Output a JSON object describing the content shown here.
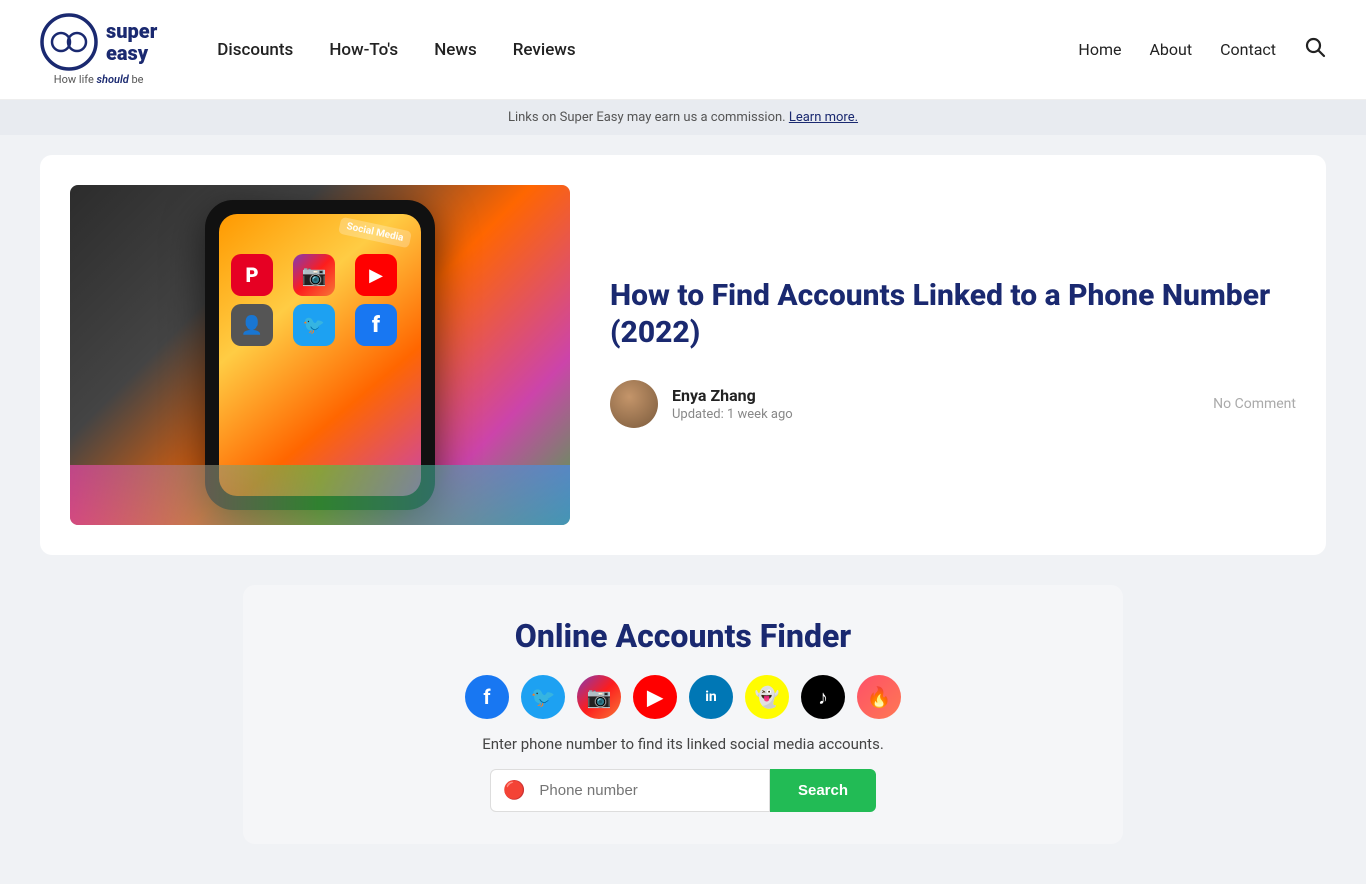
{
  "header": {
    "logo": {
      "brand1": "super",
      "brand2": "easy",
      "tagline_prefix": "How life ",
      "tagline_emphasis": "should",
      "tagline_suffix": " be"
    },
    "nav": {
      "items": [
        {
          "label": "Discounts",
          "href": "#"
        },
        {
          "label": "How-To's",
          "href": "#"
        },
        {
          "label": "News",
          "href": "#"
        },
        {
          "label": "Reviews",
          "href": "#"
        }
      ]
    },
    "secondary_nav": {
      "items": [
        {
          "label": "Home",
          "href": "#"
        },
        {
          "label": "About",
          "href": "#"
        },
        {
          "label": "Contact",
          "href": "#"
        }
      ]
    }
  },
  "commission_bar": {
    "text": "Links on Super Easy may earn us a commission.",
    "link_text": "Learn more."
  },
  "article": {
    "title": "How to Find Accounts Linked to a Phone Number (2022)",
    "author": {
      "name": "Enya Zhang",
      "updated": "Updated: 1 week ago"
    },
    "comment_count": "No Comment"
  },
  "finder": {
    "title": "Online Accounts Finder",
    "description": "Enter phone number to find its linked social media accounts.",
    "input_placeholder": "Phone number",
    "button_label": "Search",
    "social_icons": [
      {
        "name": "facebook",
        "symbol": "f",
        "class": "si-facebook"
      },
      {
        "name": "twitter",
        "symbol": "t",
        "class": "si-twitter"
      },
      {
        "name": "instagram",
        "symbol": "📷",
        "class": "si-instagram"
      },
      {
        "name": "youtube",
        "symbol": "▶",
        "class": "si-youtube"
      },
      {
        "name": "linkedin",
        "symbol": "in",
        "class": "si-linkedin"
      },
      {
        "name": "snapchat",
        "symbol": "👻",
        "class": "si-snapchat"
      },
      {
        "name": "tiktok",
        "symbol": "♪",
        "class": "si-tiktok"
      },
      {
        "name": "tinder",
        "symbol": "🔥",
        "class": "si-tinder"
      }
    ]
  }
}
